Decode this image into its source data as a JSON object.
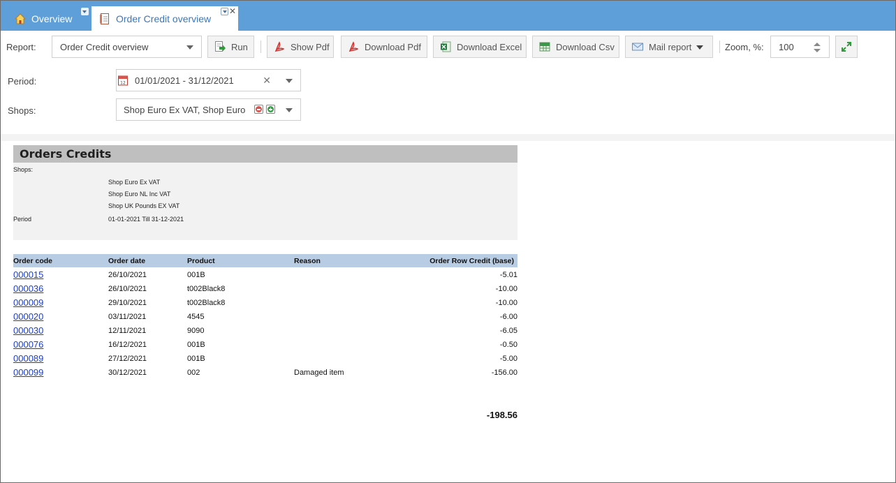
{
  "tabs": {
    "overview": "Overview",
    "active": "Order Credit overview"
  },
  "toolbar": {
    "report_label": "Report:",
    "report_value": "Order Credit overview",
    "run": "Run",
    "show_pdf": "Show Pdf",
    "download_pdf": "Download Pdf",
    "download_excel": "Download Excel",
    "download_csv": "Download Csv",
    "mail_report": "Mail report",
    "zoom_label": "Zoom, %:",
    "zoom_value": "100"
  },
  "filters": {
    "period_label": "Period:",
    "period_value": "01/01/2021 - 31/12/2021",
    "shops_label": "Shops:",
    "shops_value": "Shop Euro Ex VAT, Shop Euro"
  },
  "report": {
    "title": "Orders Credits",
    "shops_label": "Shops:",
    "shops": [
      "Shop Euro Ex VAT",
      "Shop Euro NL Inc VAT",
      "Shop UK Pounds EX VAT"
    ],
    "period_label": "Period",
    "period_value": "01-01-2021 Till 31-12-2021",
    "columns": [
      "Order code",
      "Order date",
      "Product",
      "Reason",
      "Order Row Credit (base)"
    ],
    "rows": [
      {
        "code": "000015",
        "date": "26/10/2021",
        "product": "001B",
        "reason": "",
        "credit": "-5.01"
      },
      {
        "code": "000036",
        "date": "26/10/2021",
        "product": "t002Black8",
        "reason": "",
        "credit": "-10.00"
      },
      {
        "code": "000009",
        "date": "29/10/2021",
        "product": "t002Black8",
        "reason": "",
        "credit": "-10.00"
      },
      {
        "code": "000020",
        "date": "03/11/2021",
        "product": "4545",
        "reason": "",
        "credit": "-6.00"
      },
      {
        "code": "000030",
        "date": "12/11/2021",
        "product": "9090",
        "reason": "",
        "credit": "-6.05"
      },
      {
        "code": "000076",
        "date": "16/12/2021",
        "product": "001B",
        "reason": "",
        "credit": "-0.50"
      },
      {
        "code": "000089",
        "date": "27/12/2021",
        "product": "001B",
        "reason": "",
        "credit": "-5.00"
      },
      {
        "code": "000099",
        "date": "30/12/2021",
        "product": "002",
        "reason": "Damaged item",
        "credit": "-156.00"
      }
    ],
    "total": "-198.56"
  },
  "colors": {
    "tabbar": "#5e9fd9",
    "active_tab_text": "#3a78bd",
    "report_header": "#bfbfbf",
    "table_header": "#b8cce4",
    "link": "#1a3dcf"
  },
  "icons": {
    "home": "home-icon",
    "report_doc": "document-icon",
    "run": "run-icon",
    "pdf": "pdf-icon",
    "excel": "excel-icon",
    "csv": "csv-icon",
    "mail": "mail-icon",
    "calendar": "calendar-icon",
    "fullscreen": "expand-icon"
  }
}
